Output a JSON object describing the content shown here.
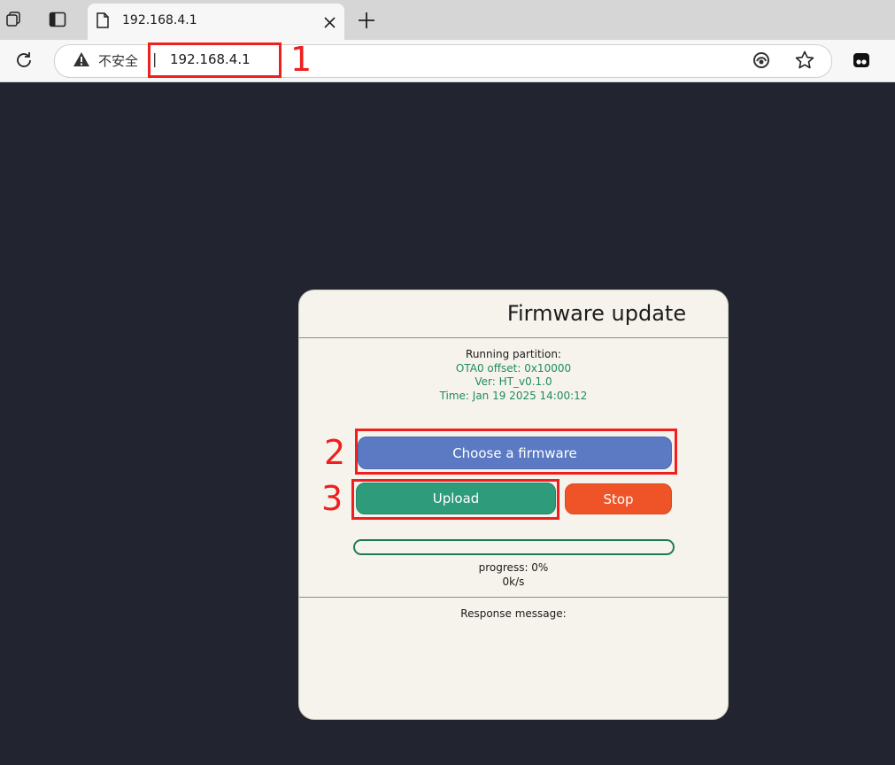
{
  "browser": {
    "tab_title": "192.168.4.1",
    "security_label": "不安全",
    "separator": "|",
    "url": "192.168.4.1",
    "new_tab_symbol": "+",
    "close_symbol": "×"
  },
  "annotations": {
    "one": "1",
    "two": "2",
    "three": "3",
    "color": "#ef1f1f"
  },
  "card": {
    "title": "Firmware update",
    "running_partition_label": "Running partition:",
    "partition": "OTA0 offset: 0x10000",
    "version": "Ver: HT_v0.1.0",
    "time": "Time: Jan 19 2025 14:00:12",
    "choose_button": "Choose a firmware",
    "upload_button": "Upload",
    "stop_button": "Stop",
    "progress_text": "progress: 0%",
    "progress_fraction": 0,
    "speed": "0k/s",
    "response_label": "Response message:"
  },
  "colors": {
    "page_bg": "#22252f",
    "card_bg": "#f6f3ec",
    "choose": "#5b7ac3",
    "upload": "#2e9c7b",
    "stop": "#ee5428",
    "info_green": "#1f8b5f"
  },
  "icons": [
    "workspaces-icon",
    "tab-actions-icon",
    "page-icon",
    "close-icon",
    "new-tab-icon",
    "reload-icon",
    "warning-icon",
    "reader-icon",
    "favorite-star-icon",
    "profile-icon"
  ]
}
